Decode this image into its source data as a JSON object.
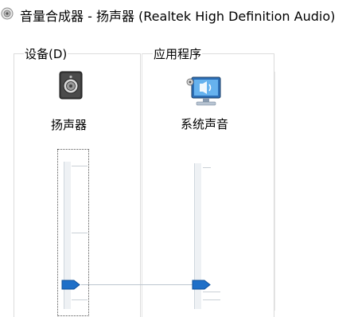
{
  "window": {
    "title": "音量合成器 - 扬声器 (Realtek High Definition Audio)",
    "app_icon": "speaker-volume-icon"
  },
  "device_group": {
    "label": "设备(D)",
    "device_name": "扬声器",
    "icon": "speaker-icon",
    "volume_level": 0.13
  },
  "apps_group": {
    "label": "应用程序",
    "app_name": "系统声音",
    "icon": "monitor-sound-icon",
    "volume_level": 0.13
  },
  "colors": {
    "accent": "#1e6fc8",
    "track": "#e6ebf0",
    "group_border": "#dcdcdc"
  }
}
